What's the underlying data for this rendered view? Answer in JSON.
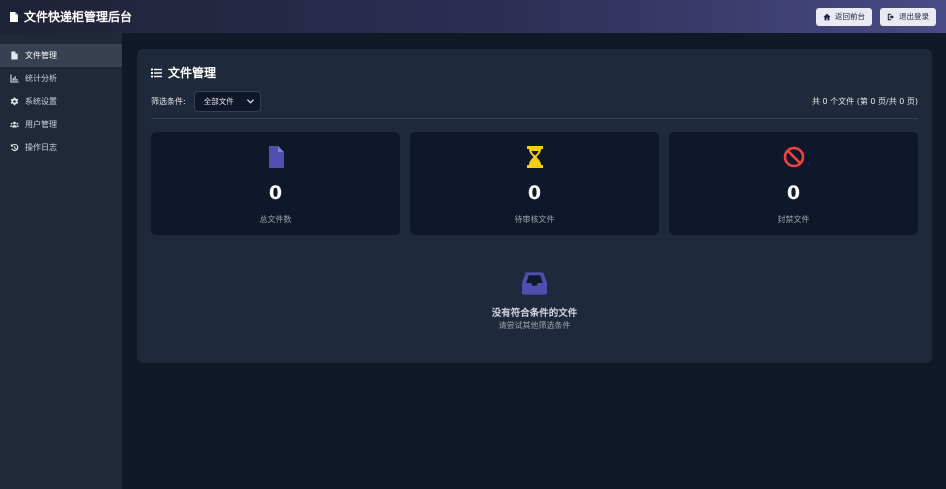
{
  "header": {
    "title": "文件快递柜管理后台",
    "back_label": "返回前台",
    "logout_label": "退出登录"
  },
  "sidebar": {
    "items": [
      {
        "label": "文件管理",
        "icon": "file-icon",
        "active": true
      },
      {
        "label": "统计分析",
        "icon": "chart-icon",
        "active": false
      },
      {
        "label": "系统设置",
        "icon": "gear-icon",
        "active": false
      },
      {
        "label": "用户管理",
        "icon": "users-icon",
        "active": false
      },
      {
        "label": "操作日志",
        "icon": "history-icon",
        "active": false
      }
    ]
  },
  "main": {
    "title": "文件管理",
    "filter_label": "筛选条件:",
    "filter_selected": "全部文件",
    "count_text": "共 0 个文件 (第 0 页/共 0 页)",
    "stats": [
      {
        "value": "0",
        "label": "总文件数",
        "icon": "file-icon",
        "color": "#4f4fb0"
      },
      {
        "value": "0",
        "label": "待审核文件",
        "icon": "hourglass-icon",
        "color": "#facc15"
      },
      {
        "value": "0",
        "label": "封禁文件",
        "icon": "ban-icon",
        "color": "#ef4444"
      }
    ],
    "empty": {
      "icon": "inbox-icon",
      "title": "没有符合条件的文件",
      "subtitle": "请尝试其他筛选条件"
    }
  },
  "colors": {
    "background": "#111827",
    "sidebar": "#1f2937",
    "panel": "#1e293b",
    "card": "#0f172a",
    "accent": "#4f4fb0"
  }
}
